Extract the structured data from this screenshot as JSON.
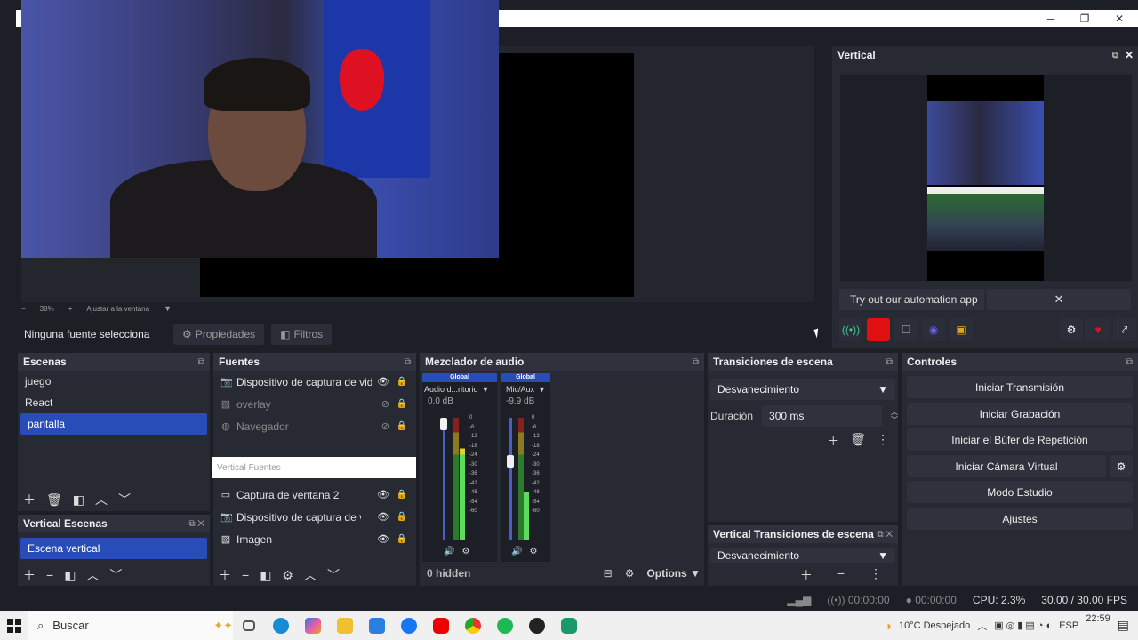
{
  "window": {
    "minimize": "─",
    "maximize": "❐",
    "close": "✕"
  },
  "preview": {
    "zoom_minus": "−",
    "zoom": "38%",
    "zoom_plus": "+",
    "fit_label": "Ajustar a la ventana"
  },
  "source_bar": {
    "selected": "Ninguna fuente selecciona",
    "properties": "Propiedades",
    "filters": "Filtros"
  },
  "vertical": {
    "title": "Vertical",
    "automation": "Try out our automation app",
    "automation_close": "✕"
  },
  "scenes": {
    "title": "Escenas",
    "items": [
      {
        "label": "juego"
      },
      {
        "label": "React"
      },
      {
        "label": "pantalla"
      }
    ]
  },
  "vertical_scenes": {
    "title": "Vertical Escenas",
    "items": [
      {
        "label": "Escena vertical"
      }
    ]
  },
  "sources": {
    "title": "Fuentes",
    "items": [
      {
        "label": "Dispositivo de captura de video"
      },
      {
        "label": "overlay"
      },
      {
        "label": "Navegador"
      }
    ],
    "vertical_header": "Vertical Fuentes",
    "vertical_items": [
      {
        "label": "Captura de ventana 2"
      },
      {
        "label": "Dispositivo de captura de video"
      },
      {
        "label": "Imagen"
      }
    ]
  },
  "mixer": {
    "title": "Mezclador de audio",
    "channels": [
      {
        "badge": "Global",
        "name": "Audio d...ritorio",
        "db": "0.0 dB"
      },
      {
        "badge": "Global",
        "name": "Mic/Aux",
        "db": "-9.9 dB"
      }
    ],
    "ticks": [
      "0",
      "-6",
      "-12",
      "-18",
      "-24",
      "-30",
      "-36",
      "-42",
      "-48",
      "-54",
      "-60"
    ],
    "hidden": "0 hidden",
    "options": "Options"
  },
  "transitions": {
    "title": "Transiciones de escena",
    "selected": "Desvanecimiento",
    "duration_label": "Duración",
    "duration_value": "300 ms"
  },
  "vertical_transitions": {
    "title": "Vertical Transiciones de escena",
    "selected": "Desvanecimiento"
  },
  "controls": {
    "title": "Controles",
    "buttons": [
      "Iniciar Transmisión",
      "Iniciar Grabación",
      "Iniciar el Búfer de Repetición",
      "Iniciar Cámara Virtual",
      "Modo Estudio",
      "Ajustes"
    ]
  },
  "status": {
    "stream_time": "00:00:00",
    "rec_time": "00:00:00",
    "cpu": "CPU: 2.3%",
    "fps": "30.00 / 30.00 FPS"
  },
  "taskbar": {
    "search": "Buscar",
    "weather": "10°C  Despejado",
    "lang": "ESP",
    "time": "22:59"
  },
  "colors": {
    "accent": "#284cb8",
    "panel": "#272a33",
    "bg": "#1d1f26"
  }
}
